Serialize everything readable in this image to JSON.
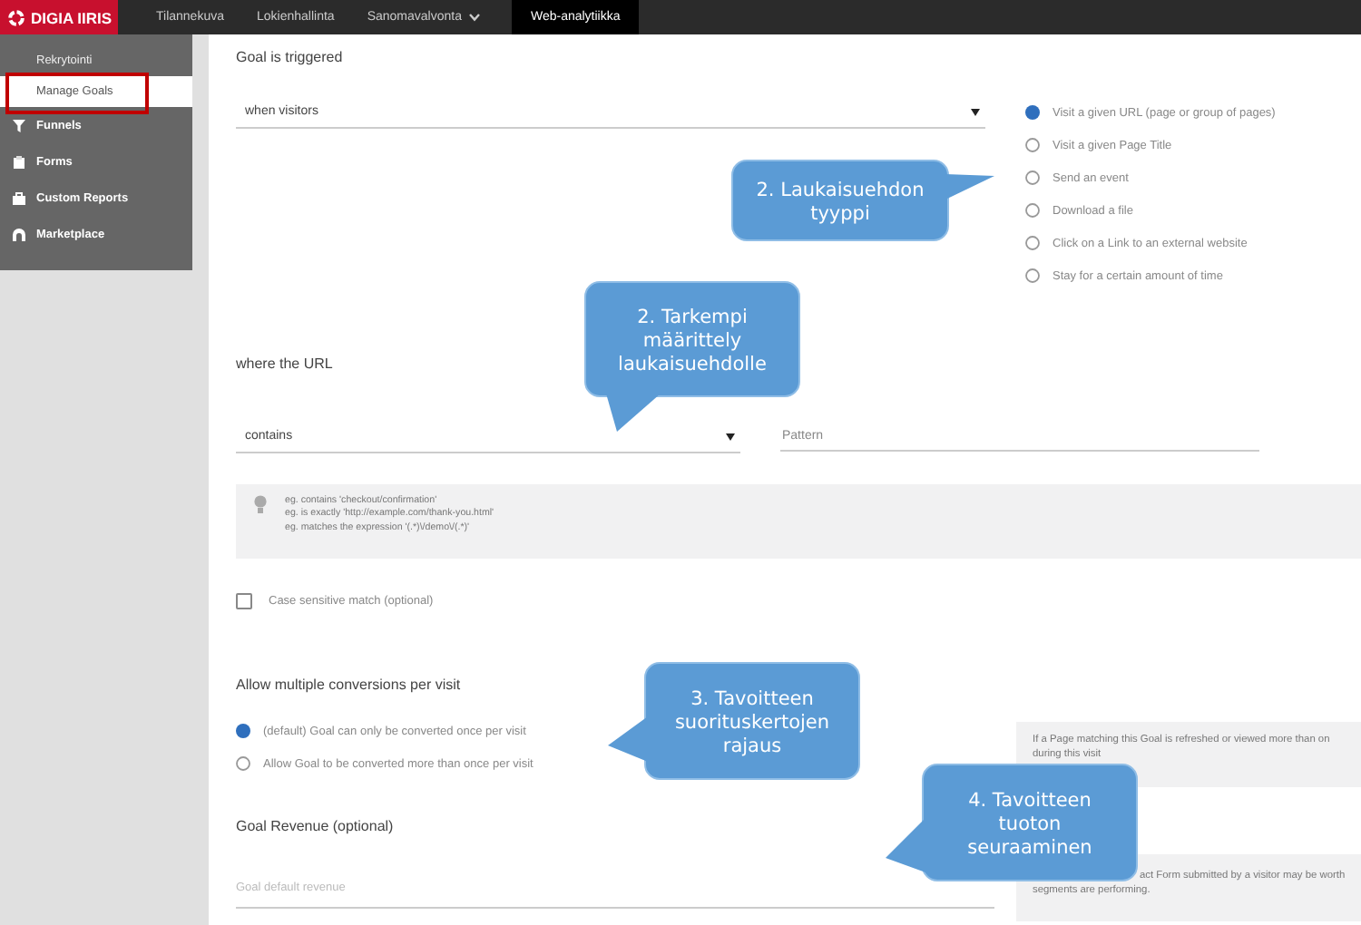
{
  "nav": {
    "logo": "DIGIA IIRIS",
    "items": [
      {
        "label": "Tilannekuva",
        "selected": false,
        "dropdown": false
      },
      {
        "label": "Lokienhallinta",
        "selected": false,
        "dropdown": false
      },
      {
        "label": "Sanomavalvonta",
        "selected": false,
        "dropdown": true
      },
      {
        "label": "Web-analytiikka",
        "selected": true,
        "dropdown": false
      }
    ]
  },
  "sidebar": {
    "items": [
      {
        "label": "Rekrytointi",
        "kind": "subitem",
        "selected": false,
        "annotated": false
      },
      {
        "label": "Manage Goals",
        "kind": "subitem",
        "selected": true,
        "annotated": true
      },
      {
        "label": "Funnels",
        "kind": "section",
        "selected": false,
        "annotated": false
      },
      {
        "label": "Forms",
        "kind": "section",
        "selected": false,
        "annotated": false
      },
      {
        "label": "Custom Reports",
        "kind": "section",
        "selected": false,
        "annotated": false
      },
      {
        "label": "Marketplace",
        "kind": "section",
        "selected": false,
        "annotated": false
      }
    ]
  },
  "trigger": {
    "title": "Goal is triggered",
    "select": {
      "value": "when visitors"
    },
    "options": [
      {
        "label": "Visit a given URL (page or group of pages)",
        "selected": true
      },
      {
        "label": "Visit a given Page Title",
        "selected": false
      },
      {
        "label": "Send an event",
        "selected": false
      },
      {
        "label": "Download a file",
        "selected": false
      },
      {
        "label": "Click on a Link to an external website",
        "selected": false
      },
      {
        "label": "Stay for a certain amount of time",
        "selected": false
      }
    ]
  },
  "url": {
    "title": "where the URL",
    "operator": {
      "value": "contains"
    },
    "pattern": {
      "placeholder": "Pattern"
    },
    "hints": [
      "eg. contains 'checkout/confirmation'",
      "eg. is exactly 'http://example.com/thank-you.html'",
      "eg. matches the expression '(.*)\\/demo\\/(.*)'"
    ],
    "case_sensitive": {
      "label": "Case sensitive match (optional)",
      "checked": false
    }
  },
  "conversions": {
    "title": "Allow multiple conversions per visit",
    "options": [
      {
        "label": "(default) Goal can only be converted once per visit",
        "selected": true
      },
      {
        "label": "Allow Goal to be converted more than once per visit",
        "selected": false
      }
    ],
    "info": [
      "If a Page matching this Goal is refreshed or viewed more than on",
      "during this visit"
    ]
  },
  "revenue": {
    "title": "Goal Revenue (optional)",
    "field": {
      "placeholder": "Goal default revenue"
    },
    "info": [
      "act Form submitted by a visitor may be worth",
      "segments are performing."
    ]
  },
  "callouts": [
    {
      "lines": [
        "2. Laukaisuehdon",
        "tyyppi"
      ]
    },
    {
      "lines": [
        "2. Tarkempi",
        "määrittely",
        "laukaisuehdolle"
      ]
    },
    {
      "lines": [
        "3. Tavoitteen",
        "suorituskertojen",
        "rajaus"
      ]
    },
    {
      "lines": [
        "4. Tavoitteen",
        "tuoton",
        "seuraaminen"
      ]
    }
  ]
}
